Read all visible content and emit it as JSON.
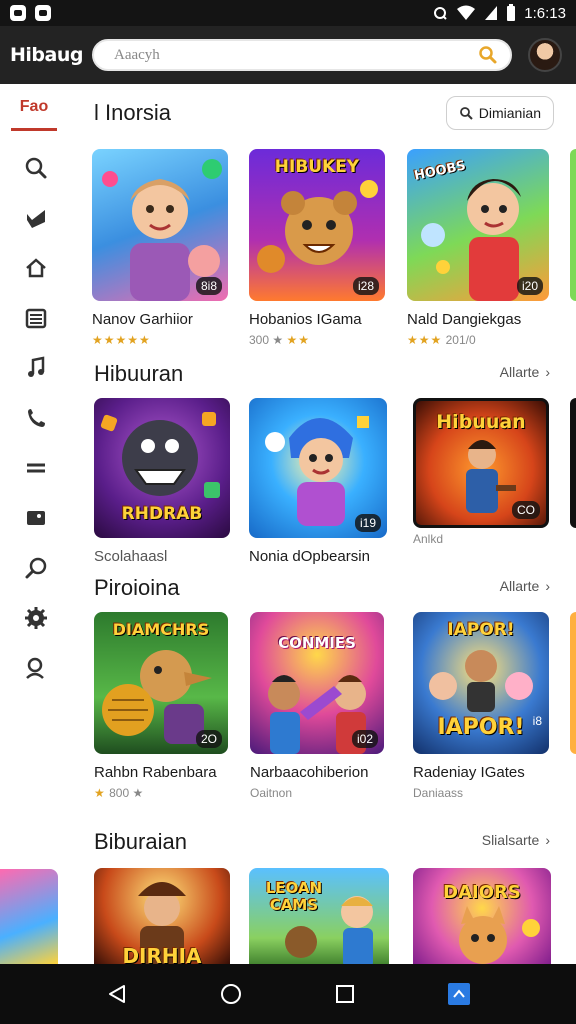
{
  "status": {
    "time": "1:6:13"
  },
  "app": {
    "logo": "Hibaug",
    "search_placeholder": "Aaacyh"
  },
  "sidebar": {
    "fav_label": "Fao"
  },
  "section1": {
    "title": "l Inorsia",
    "filter_label": "Dimianian",
    "cards": [
      {
        "name": "Nanov Garhiior",
        "sub_stars": "★★★★★",
        "sub_text": "",
        "rate": "8i8",
        "thumb_text": ""
      },
      {
        "name": "Hobanios IGama",
        "sub_stars": "★★",
        "sub_text": "300 ★",
        "rate": "i28",
        "thumb_text": "HIBUKEY"
      },
      {
        "name": "Nald Dangiekgas",
        "sub_stars": "★★★",
        "sub_text": "201/0",
        "rate": "i20",
        "thumb_text": "HOOBS"
      }
    ]
  },
  "section2": {
    "title": "Hibuuran",
    "see_all": "Allarte",
    "cards": [
      {
        "name": "Scolahaasl",
        "sub_text": "",
        "rate": "",
        "thumb_text": "RHDRAB"
      },
      {
        "name": "Nonia dOpbearsin",
        "sub_text": "",
        "rate": "i19",
        "thumb_text": ""
      },
      {
        "name": "Anlkd",
        "sub_text": "",
        "rate": "CO",
        "thumb_text": "Hibuuan"
      }
    ]
  },
  "section3": {
    "title": "Piroioina",
    "see_all": "Allarte",
    "cards": [
      {
        "name": "Rahbn Rabenbara",
        "sub_stars": "★",
        "sub_text": "800 ★",
        "rate": "2O",
        "thumb_text": "DIAMCHRS"
      },
      {
        "name": "Narbaacohiberion",
        "sub_text": "Oaitnon",
        "rate": "i02",
        "thumb_text": "CONMIES"
      },
      {
        "name": "Radeniay IGates",
        "sub_text": "Daniaass",
        "rate": "i8",
        "thumb_text": "IAPOR!"
      }
    ]
  },
  "section4": {
    "title": "Biburaian",
    "see_all": "Slialsarte",
    "cards": [
      {
        "thumb_text": "DIRHIA"
      },
      {
        "thumb_text": "LEOAN CAMS"
      },
      {
        "thumb_text": "DAIORS"
      }
    ]
  },
  "colors": {
    "accent": "#c0392b",
    "dark": "#232323",
    "star": "#e2a321",
    "search_icon": "#e8a72b"
  }
}
